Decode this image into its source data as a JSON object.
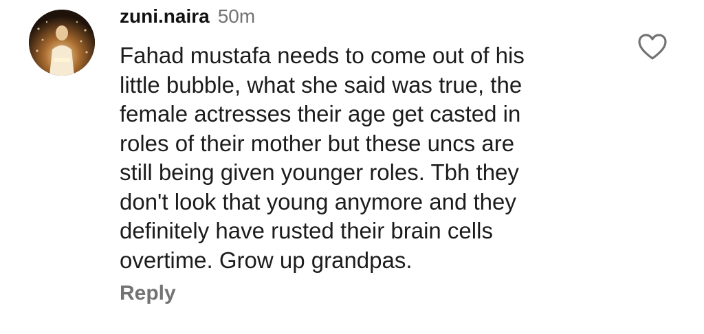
{
  "comment": {
    "username": "zuni.naira",
    "time": "50m",
    "text_lines": [
      "Fahad mustafa needs to come out of his",
      "little bubble, what she said was true, the",
      "female actresses their age get casted in",
      "roles of their mother but these uncs are",
      "still being given younger roles. Tbh they",
      "don't look that young anymore and they",
      "definitely have rusted their brain cells",
      "overtime. Grow up grandpas."
    ],
    "reply_label": "Reply",
    "like_icon": "heart-outline-icon"
  },
  "colors": {
    "username": "#111111",
    "meta": "#737373",
    "text": "#1c1c1c",
    "background": "#ffffff"
  }
}
